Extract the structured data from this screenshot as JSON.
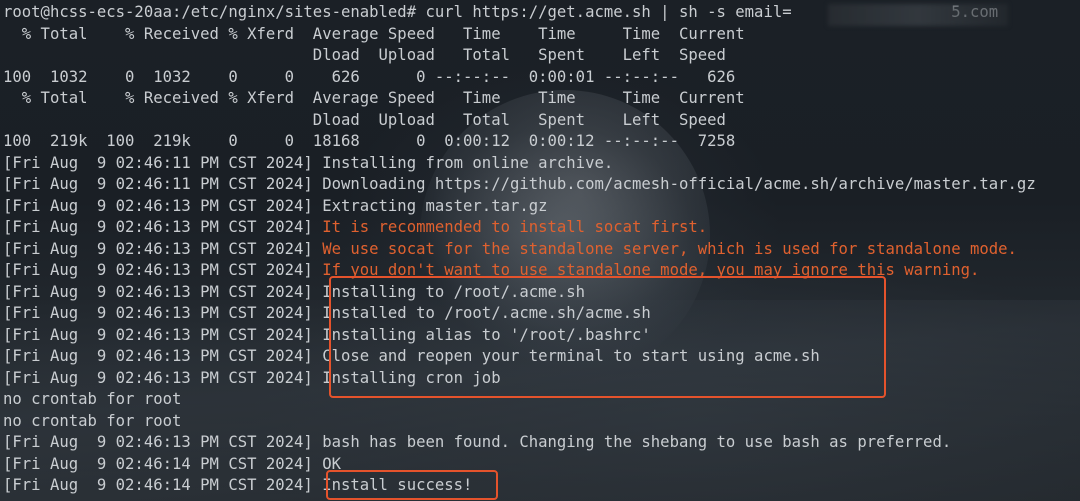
{
  "lines": [
    {
      "ts": "",
      "text": "root@hcss-ecs-20aa:/etc/nginx/sites-enabled# curl https://get.acme.sh | sh -s email=                 5.com",
      "kind": "normal"
    },
    {
      "ts": "",
      "text": "  % Total    % Received % Xferd  Average Speed   Time    Time     Time  Current",
      "kind": "normal"
    },
    {
      "ts": "",
      "text": "                                 Dload  Upload   Total   Spent    Left  Speed",
      "kind": "normal"
    },
    {
      "ts": "",
      "text": "100  1032    0  1032    0     0    626      0 --:--:--  0:00:01 --:--:--   626",
      "kind": "normal"
    },
    {
      "ts": "",
      "text": "  % Total    % Received % Xferd  Average Speed   Time    Time     Time  Current",
      "kind": "normal"
    },
    {
      "ts": "",
      "text": "                                 Dload  Upload   Total   Spent    Left  Speed",
      "kind": "normal"
    },
    {
      "ts": "",
      "text": "100  219k  100  219k    0     0  18168      0  0:00:12  0:00:12 --:--:--  7258",
      "kind": "normal"
    },
    {
      "ts": "[Fri Aug  9 02:46:11 PM CST 2024] ",
      "text": "Installing from online archive.",
      "kind": "normal"
    },
    {
      "ts": "[Fri Aug  9 02:46:11 PM CST 2024] ",
      "text": "Downloading https://github.com/acmesh-official/acme.sh/archive/master.tar.gz",
      "kind": "normal"
    },
    {
      "ts": "[Fri Aug  9 02:46:13 PM CST 2024] ",
      "text": "Extracting master.tar.gz",
      "kind": "normal"
    },
    {
      "ts": "[Fri Aug  9 02:46:13 PM CST 2024] ",
      "text": "It is recommended to install socat first.",
      "kind": "warn"
    },
    {
      "ts": "[Fri Aug  9 02:46:13 PM CST 2024] ",
      "text": "We use socat for the standalone server, which is used for standalone mode.",
      "kind": "warn"
    },
    {
      "ts": "[Fri Aug  9 02:46:13 PM CST 2024] ",
      "text": "If you don't want to use standalone mode, you may ignore this warning.",
      "kind": "warn"
    },
    {
      "ts": "[Fri Aug  9 02:46:13 PM CST 2024] ",
      "text": "Installing to /root/.acme.sh",
      "kind": "normal"
    },
    {
      "ts": "[Fri Aug  9 02:46:13 PM CST 2024] ",
      "text": "Installed to /root/.acme.sh/acme.sh",
      "kind": "normal"
    },
    {
      "ts": "[Fri Aug  9 02:46:13 PM CST 2024] ",
      "text": "Installing alias to '/root/.bashrc'",
      "kind": "normal"
    },
    {
      "ts": "[Fri Aug  9 02:46:13 PM CST 2024] ",
      "text": "Close and reopen your terminal to start using acme.sh",
      "kind": "normal"
    },
    {
      "ts": "[Fri Aug  9 02:46:13 PM CST 2024] ",
      "text": "Installing cron job",
      "kind": "normal"
    },
    {
      "ts": "",
      "text": "no crontab for root",
      "kind": "normal"
    },
    {
      "ts": "",
      "text": "no crontab for root",
      "kind": "normal"
    },
    {
      "ts": "[Fri Aug  9 02:46:13 PM CST 2024] ",
      "text": "bash has been found. Changing the shebang to use bash as preferred.",
      "kind": "normal"
    },
    {
      "ts": "[Fri Aug  9 02:46:14 PM CST 2024] ",
      "text": "OK",
      "kind": "normal"
    },
    {
      "ts": "[Fri Aug  9 02:46:14 PM CST 2024] ",
      "text": "Install success!",
      "kind": "normal"
    }
  ],
  "colors": {
    "text": "#c9cdd1",
    "warning": "#e0612f",
    "highlight_box": "#e5532c"
  }
}
